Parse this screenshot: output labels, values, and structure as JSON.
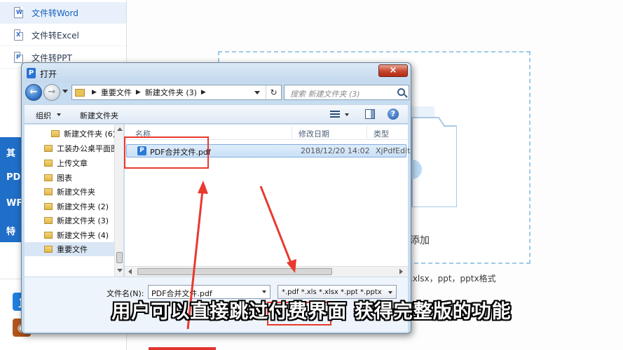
{
  "sidebar": {
    "items": [
      {
        "label": "文件转Word",
        "icon_letter": "W"
      },
      {
        "label": "文件转Excel",
        "icon_letter": "X"
      },
      {
        "label": "文件转PPT",
        "icon_letter": "P"
      }
    ],
    "band_items": [
      "其",
      "PD",
      "WF",
      "特"
    ]
  },
  "app": {
    "drop_text": "添加",
    "format_text": ".xlsx，ppt，pptx格式"
  },
  "dialog": {
    "title": "打开",
    "close_glyph": "×",
    "address": {
      "segment_1": "重要文件",
      "segment_2": "新建文件夹 (3)"
    },
    "search_placeholder": "搜索 新建文件夹 (3)",
    "toolbar": {
      "organize": "组织",
      "new_folder": "新建文件夹"
    },
    "tree": [
      {
        "label": "新建文件夹 (6)",
        "selected": false
      },
      {
        "label": "工装办公桌平面图",
        "selected": false
      },
      {
        "label": "上传文章",
        "selected": false
      },
      {
        "label": "图表",
        "selected": false
      },
      {
        "label": "新建文件夹",
        "selected": false
      },
      {
        "label": "新建文件夹 (2)",
        "selected": false
      },
      {
        "label": "新建文件夹 (3)",
        "selected": false
      },
      {
        "label": "新建文件夹 (4)",
        "selected": false
      },
      {
        "label": "重要文件",
        "selected": true
      }
    ],
    "columns": {
      "name": "名称",
      "date": "修改日期",
      "type": "类型"
    },
    "files": [
      {
        "name": "PDF合并文件.pdf",
        "date": "2018/12/20 14:02",
        "type": "XjPdfEdit"
      }
    ],
    "filename_label": "文件名(N):",
    "filename_value": "PDF合并文件.pdf",
    "filetype_value": "*.pdf *.xls *.xlsx *.ppt *.pptx"
  },
  "subtitle": "用户可以直接跳过付费界面 获得完整版的功能",
  "colors": {
    "annotation_red": "#e8392f",
    "accent_blue": "#1f6ec8"
  }
}
